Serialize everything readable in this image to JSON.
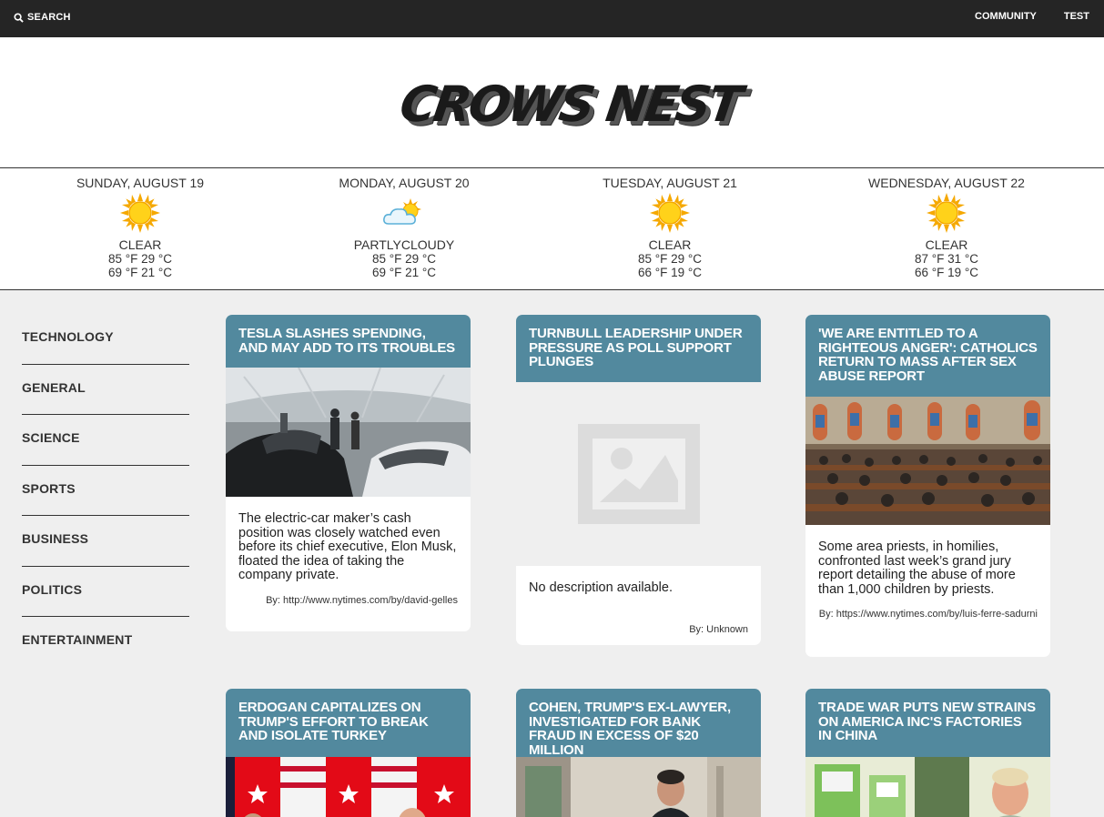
{
  "topbar": {
    "search_label": "SEARCH",
    "nav": [
      "COMMUNITY",
      "TEST"
    ]
  },
  "masthead": {
    "logo_text": "CROWS NEST"
  },
  "weather": [
    {
      "date": "SUNDAY, AUGUST 19",
      "icon": "sun-icon",
      "condition": "CLEAR",
      "high": "85 °F 29 °C",
      "low": "69 °F 21 °C"
    },
    {
      "date": "MONDAY, AUGUST 20",
      "icon": "partly-cloudy-icon",
      "condition": "PARTLYCLOUDY",
      "high": "85 °F 29 °C",
      "low": "69 °F 21 °C"
    },
    {
      "date": "TUESDAY, AUGUST 21",
      "icon": "sun-icon",
      "condition": "CLEAR",
      "high": "85 °F 29 °C",
      "low": "66 °F 19 °C"
    },
    {
      "date": "WEDNESDAY, AUGUST 22",
      "icon": "sun-icon",
      "condition": "CLEAR",
      "high": "87 °F 31 °C",
      "low": "66 °F 19 °C"
    }
  ],
  "sidebar": {
    "items": [
      "TECHNOLOGY",
      "GENERAL",
      "SCIENCE",
      "SPORTS",
      "BUSINESS",
      "POLITICS",
      "ENTERTAINMENT"
    ]
  },
  "articles": [
    {
      "title": "TESLA SLASHES SPENDING, AND MAY ADD TO ITS TROUBLES",
      "image": "factory-photo",
      "description": "The electric-car maker’s cash position was closely watched even before its chief executive, Elon Musk, floated the idea of taking the company private.",
      "byline": "By: http://www.nytimes.com/by/david-gelles"
    },
    {
      "title": "TURNBULL LEADERSHIP UNDER PRESSURE AS POLL SUPPORT PLUNGES",
      "image": "image-placeholder-icon",
      "description": "No description available.",
      "byline": "By: Unknown"
    },
    {
      "title": "'WE ARE ENTITLED TO A RIGHTEOUS ANGER': CATHOLICS RETURN TO MASS AFTER SEX ABUSE REPORT",
      "image": "church-photo",
      "description": "Some area priests, in homilies, confronted last week’s grand jury report detailing the abuse of more than 1,000 children by priests.",
      "byline": "By: https://www.nytimes.com/by/luis-ferre-sadurni"
    },
    {
      "title": "ERDOGAN CAPITALIZES ON TRUMP'S EFFORT TO BREAK AND ISOLATE TURKEY",
      "image": "flags-photo"
    },
    {
      "title": "COHEN, TRUMP'S EX-LAWYER, INVESTIGATED FOR BANK FRAUD IN EXCESS OF $20 MILLION",
      "image": "street-photo"
    },
    {
      "title": "TRADE WAR PUTS NEW STRAINS ON AMERICA INC'S FACTORIES IN CHINA",
      "image": "factory-worker-photo"
    }
  ]
}
